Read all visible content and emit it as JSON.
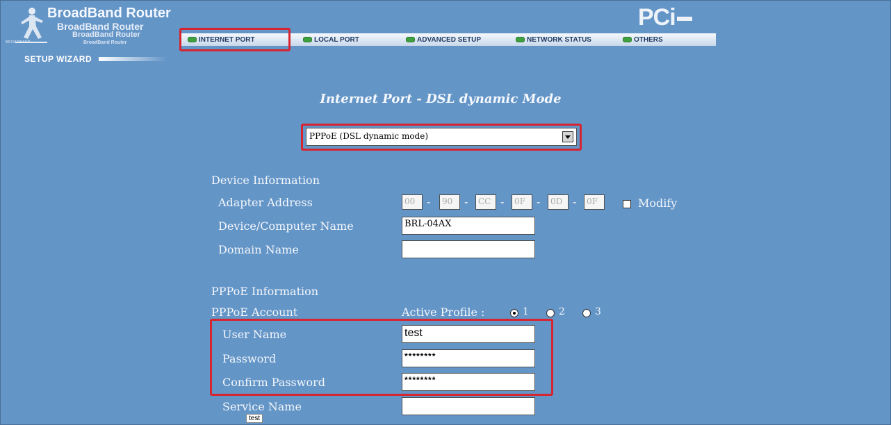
{
  "brand": {
    "line1": "BroadBand Router",
    "line2": "BroadBand Router",
    "line3": "BroadBand Router",
    "line4": "BroadBand Router",
    "small": "BROADBAND",
    "wizard": "SETUP WIZARD",
    "logo": "PCi"
  },
  "nav": {
    "tabs": [
      {
        "label": "INTERNET PORT"
      },
      {
        "label": "LOCAL PORT"
      },
      {
        "label": "ADVANCED SETUP"
      },
      {
        "label": "NETWORK STATUS"
      },
      {
        "label": "OTHERS"
      }
    ],
    "selected": "INTERNET PORT"
  },
  "page": {
    "title": "Internet Port - DSL dynamic Mode",
    "mode_select": "PPPoE (DSL dynamic mode)"
  },
  "device": {
    "section": "Device Information",
    "adapter_label": "Adapter Address",
    "mac": [
      "00",
      "90",
      "CC",
      "0F",
      "0D",
      "0F"
    ],
    "modify_label": "Modify",
    "name_label": "Device/Computer Name",
    "name_value": "BRL-04AX",
    "domain_label": "Domain Name",
    "domain_value": ""
  },
  "pppoe": {
    "section": "PPPoE Information",
    "account_label": "PPPoE Account",
    "active_profile_label": "Active Profile :",
    "profiles": [
      "1",
      "2",
      "3"
    ],
    "active_profile": "1",
    "user_label": "User Name",
    "user_value": "test",
    "password_label": "Password",
    "password_value": "********",
    "confirm_label": "Confirm Password",
    "confirm_value": "********",
    "service_label": "Service Name",
    "service_value": "",
    "tooltip": "test"
  },
  "colors": {
    "background": "#6495c7",
    "highlight": "#d62430"
  }
}
